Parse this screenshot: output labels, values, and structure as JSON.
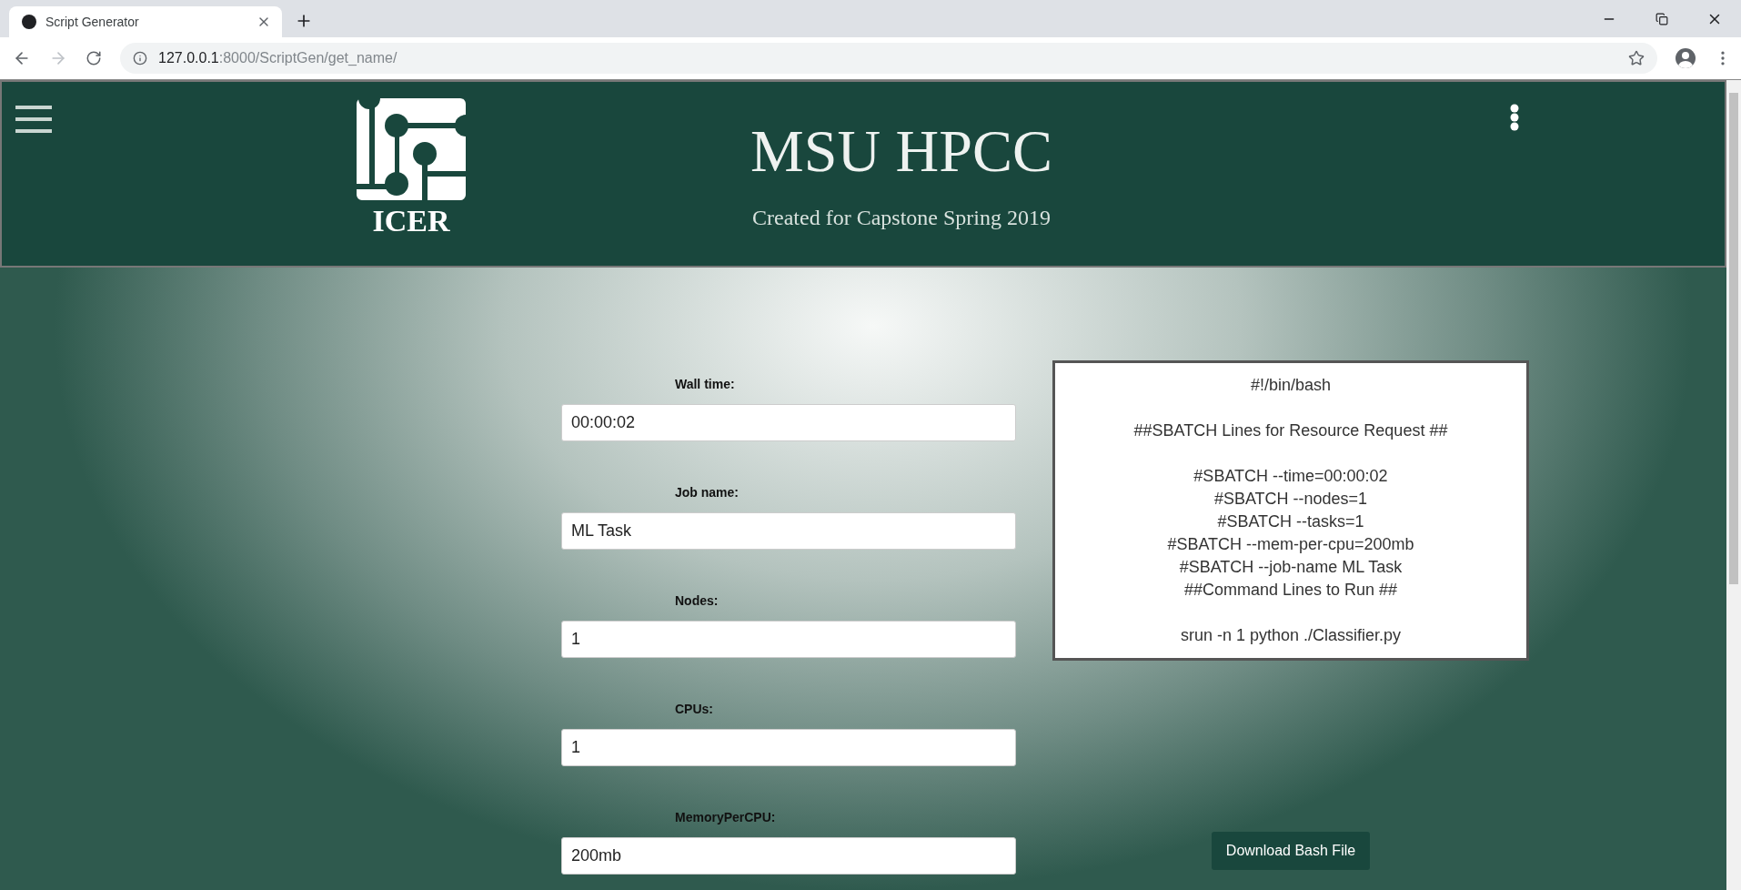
{
  "browser": {
    "tab": {
      "title": "Script Generator",
      "selected": true
    },
    "url": {
      "host": "127.0.0.1",
      "path": ":8000/ScriptGen/get_name/"
    }
  },
  "header": {
    "title": "MSU HPCC",
    "subtitle": "Created for Capstone Spring 2019",
    "logo_text": "ICER"
  },
  "form": {
    "fields": [
      {
        "label": "Wall time:",
        "value": "00:00:02"
      },
      {
        "label": "Job name:",
        "value": "ML Task"
      },
      {
        "label": "Nodes:",
        "value": "1"
      },
      {
        "label": "CPUs:",
        "value": "1"
      },
      {
        "label": "MemoryPerCPU:",
        "value": "200mb"
      }
    ]
  },
  "script": {
    "blocks": [
      [
        "#!/bin/bash"
      ],
      [
        "##SBATCH Lines for Resource Request ##"
      ],
      [
        "#SBATCH --time=00:00:02",
        "#SBATCH --nodes=1",
        "#SBATCH --tasks=1",
        "#SBATCH --mem-per-cpu=200mb",
        "#SBATCH --job-name ML Task",
        "##Command Lines to Run ##"
      ],
      [
        "srun -n 1 python ./Classifier.py"
      ]
    ]
  },
  "download_button": "Download Bash File"
}
